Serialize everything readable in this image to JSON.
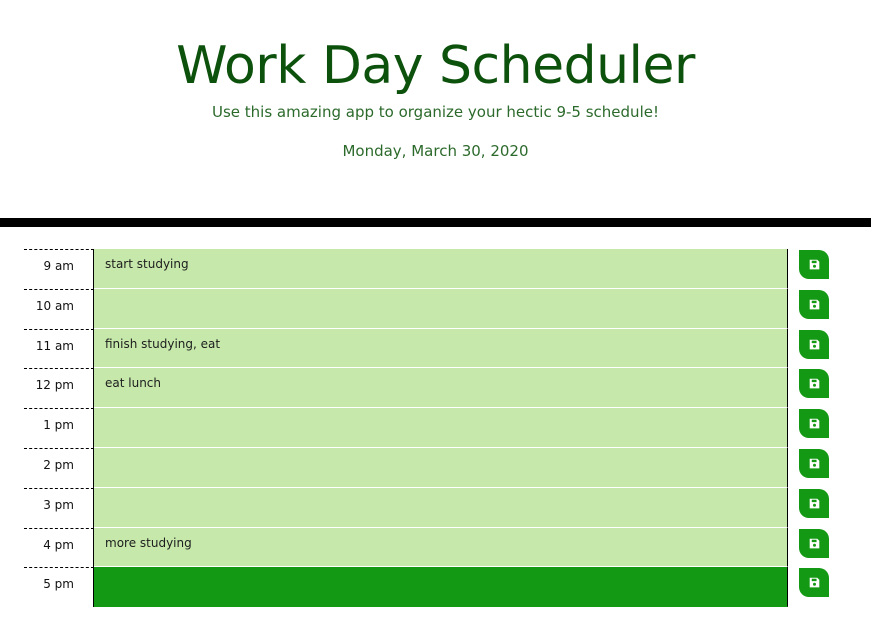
{
  "header": {
    "title": "Work Day Scheduler",
    "subtitle": "Use this amazing app to organize your hectic 9-5 schedule!",
    "current_date": "Monday, March 30, 2020"
  },
  "schedule": {
    "rows": [
      {
        "hour": "9 am",
        "text": "start studying",
        "state": "future"
      },
      {
        "hour": "10 am",
        "text": "",
        "state": "future"
      },
      {
        "hour": "11 am",
        "text": "finish studying, eat",
        "state": "future"
      },
      {
        "hour": "12 pm",
        "text": "eat lunch",
        "state": "future"
      },
      {
        "hour": "1 pm",
        "text": "",
        "state": "future"
      },
      {
        "hour": "2 pm",
        "text": "",
        "state": "future"
      },
      {
        "hour": "3 pm",
        "text": "",
        "state": "future"
      },
      {
        "hour": "4 pm",
        "text": "more studying",
        "state": "future"
      },
      {
        "hour": "5 pm",
        "text": "",
        "state": "present"
      }
    ],
    "save_icon": "save-icon"
  },
  "colors": {
    "title": "#0c510c",
    "future_row": "#c6e9ab",
    "present_row": "#139913",
    "save_button": "#139913"
  }
}
